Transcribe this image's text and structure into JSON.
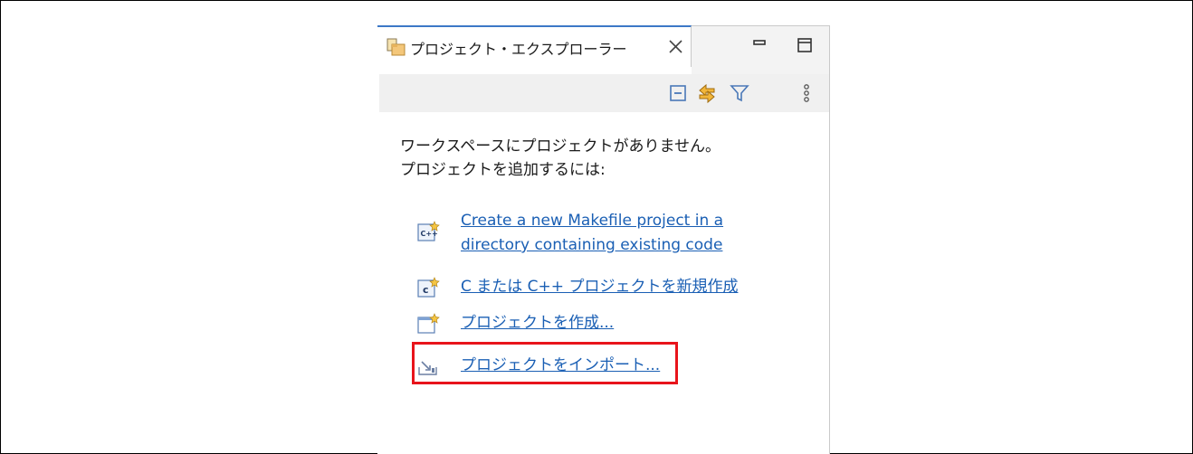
{
  "view": {
    "tab_title": "プロジェクト・エクスプローラー",
    "empty_message": [
      "ワークスペースにプロジェクトがありません。",
      "プロジェクトを追加するには:"
    ],
    "links": [
      {
        "name": "create-makefile-project-link",
        "icon": "cpp-makefile-project-icon",
        "lines": [
          "Create a new Makefile project in a",
          "directory containing existing code"
        ]
      },
      {
        "name": "new-c-cpp-project-link",
        "icon": "c-project-icon",
        "lines": [
          "C または C++ プロジェクトを新規作成"
        ]
      },
      {
        "name": "create-project-link",
        "icon": "new-project-icon",
        "lines": [
          "プロジェクトを作成..."
        ]
      },
      {
        "name": "import-project-link",
        "icon": "import-icon",
        "lines": [
          "プロジェクトをインポート..."
        ]
      }
    ]
  },
  "colors": {
    "link": "#1a5fb4",
    "highlight": "#e8141b",
    "tab_accent": "#3d78c7"
  }
}
